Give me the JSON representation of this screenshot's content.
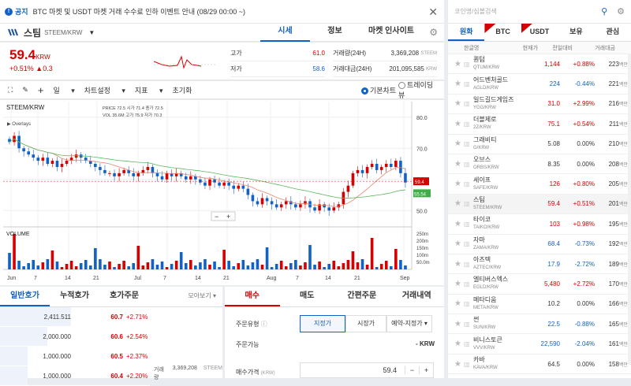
{
  "notice": {
    "tag": "공지",
    "text": "BTC 마켓 및 USDT 마켓 거래 수수료 인하 이벤트 안내 (08/29 00:00 ~)"
  },
  "coin": {
    "name": "스팀",
    "code": "STEEM/KRW",
    "tabs": [
      "시세",
      "정보",
      "마켓 인사이트"
    ]
  },
  "price": {
    "value": "59.4",
    "unit": "KRW",
    "change_pct": "+0.51%",
    "change_abs": "▲0.3",
    "high_label": "고가",
    "high": "61.0",
    "low_label": "저가",
    "low": "58.6",
    "vol_label": "거래량(24H)",
    "vol": "3,369,208",
    "vol_unit": "STEEM",
    "amt_label": "거래대금(24H)",
    "amt": "201,095,585",
    "amt_unit": "KRW"
  },
  "toolbar": {
    "period": "일",
    "settings": "차트설정",
    "indicator": "지표",
    "reset": "초기화",
    "basic": "기본차트",
    "tv": "트레이딩뷰"
  },
  "chart_data": {
    "type": "candlestick",
    "title": "STEEM/KRW",
    "ohlc_label": {
      "price": "PRICE",
      "price_v": "72.5",
      "open": "시가",
      "open_v": "71.4",
      "close": "종가",
      "close_v": "72.5",
      "vol": "VOL",
      "vol_v": "35.6M",
      "high": "고가",
      "high_v": "75.9",
      "low": "저가",
      "low_v": "70.3"
    },
    "overlays": "Overlays",
    "volume_label": "VOLUME",
    "y_ticks": [
      "80.0",
      "70.0",
      "60.0",
      "50.0"
    ],
    "vol_ticks": [
      "250m",
      "200m",
      "150m",
      "100m",
      "50.0m"
    ],
    "x_ticks": [
      "Jun",
      "7",
      "14",
      "21",
      "Jul",
      "7",
      "14",
      "21",
      "Aug",
      "7",
      "14",
      "21",
      "Sep"
    ],
    "current_price": "59.4",
    "ma_price": "55.54",
    "ylim": [
      45,
      85
    ],
    "closes": [
      72,
      74,
      70,
      69,
      68,
      67,
      66,
      67,
      65,
      66,
      64,
      65,
      66,
      67,
      68,
      67,
      66,
      65,
      64,
      63,
      62,
      62,
      61,
      62,
      63,
      62,
      61,
      62,
      63,
      64,
      62,
      61,
      60,
      62,
      61,
      62,
      61,
      60,
      61,
      60,
      59,
      58,
      60,
      59,
      58,
      59,
      58,
      57,
      58,
      57,
      55,
      53,
      52,
      54,
      53,
      52,
      51,
      52,
      53,
      52,
      51,
      52,
      53,
      51,
      50,
      52,
      51,
      50,
      51,
      52,
      56,
      58,
      62,
      63,
      62,
      64,
      65,
      63,
      64,
      65,
      64,
      66,
      62,
      59
    ]
  },
  "orderbook": {
    "tabs": [
      "일반호가",
      "누적호가",
      "호가주문"
    ],
    "more": "모아보기 ▾",
    "rows": [
      {
        "q": "2,411.511",
        "p": "60.7",
        "r": "+2.71%"
      },
      {
        "q": "2,000.000",
        "p": "60.6",
        "r": "+2.54%"
      },
      {
        "q": "1,000.000",
        "p": "60.5",
        "r": "+2.37%"
      },
      {
        "q": "1,000.000",
        "p": "60.4",
        "r": "+2.20%"
      }
    ],
    "side_label": "거래량",
    "side_value": "3,369,208",
    "side_unit": "STEEM"
  },
  "orderform": {
    "tabs": [
      "매수",
      "매도",
      "간편주문",
      "거래내역"
    ],
    "type_label": "주문유형",
    "types": [
      "지정가",
      "시장가",
      "예약-지정가"
    ],
    "avail_label": "주문가능",
    "avail": "- KRW",
    "price_label": "매수가격",
    "price_unit": "(KRW)",
    "price": "59.4"
  },
  "market": {
    "search": "코인명/심볼검색",
    "tabs": [
      "원화",
      "BTC",
      "USDT",
      "보유",
      "관심"
    ],
    "head": [
      "한글명",
      "현재가",
      "전일대비",
      "거래대금"
    ],
    "rows": [
      {
        "n": "퀀텀",
        "c": "QTUM/KRW",
        "p": "1,144",
        "ch": "+0.88%",
        "v": "223",
        "d": "up"
      },
      {
        "n": "어드벤처골드",
        "c": "AGLD/KRW",
        "p": "224",
        "ch": "-0.44%",
        "v": "221",
        "d": "down"
      },
      {
        "n": "일드길드게임즈",
        "c": "YGG/KRW",
        "p": "31.0",
        "ch": "+2.99%",
        "v": "216",
        "d": "up"
      },
      {
        "n": "더블제로",
        "c": "2Z/KRW",
        "p": "75.1",
        "ch": "+0.54%",
        "v": "211",
        "d": "up"
      },
      {
        "n": "그래비티",
        "c": "G/KRW",
        "p": "5.08",
        "ch": "0.00%",
        "v": "210",
        "d": "flat"
      },
      {
        "n": "오브스",
        "c": "ORBS/KRW",
        "p": "8.35",
        "ch": "0.00%",
        "v": "208",
        "d": "flat"
      },
      {
        "n": "세이프",
        "c": "SAFE/KRW",
        "p": "126",
        "ch": "+0.80%",
        "v": "205",
        "d": "up"
      },
      {
        "n": "스팀",
        "c": "STEEM/KRW",
        "p": "59.4",
        "ch": "+0.51%",
        "v": "201",
        "d": "up"
      },
      {
        "n": "타이코",
        "c": "TAIKO/KRW",
        "p": "103",
        "ch": "+0.98%",
        "v": "195",
        "d": "up"
      },
      {
        "n": "자마",
        "c": "ZAMA/KRW",
        "p": "68.4",
        "ch": "-0.73%",
        "v": "192",
        "d": "down"
      },
      {
        "n": "아즈텍",
        "c": "AZTEC/KRW",
        "p": "17.9",
        "ch": "-2.72%",
        "v": "189",
        "d": "down"
      },
      {
        "n": "엘티버스엑스",
        "c": "EGLD/KRW",
        "p": "5,480",
        "ch": "+2.72%",
        "v": "170",
        "d": "up"
      },
      {
        "n": "메타디움",
        "c": "META/KRW",
        "p": "10.2",
        "ch": "0.00%",
        "v": "166",
        "d": "flat"
      },
      {
        "n": "썬",
        "c": "SUN/KRW",
        "p": "22.5",
        "ch": "-0.88%",
        "v": "165",
        "d": "down"
      },
      {
        "n": "비니스토큰",
        "c": "VVV/KRW",
        "p": "22,590",
        "ch": "-2.04%",
        "v": "161",
        "d": "down"
      },
      {
        "n": "카바",
        "c": "KAVA/KRW",
        "p": "64.5",
        "ch": "0.00%",
        "v": "158",
        "d": "flat"
      }
    ],
    "unit": "백만"
  }
}
